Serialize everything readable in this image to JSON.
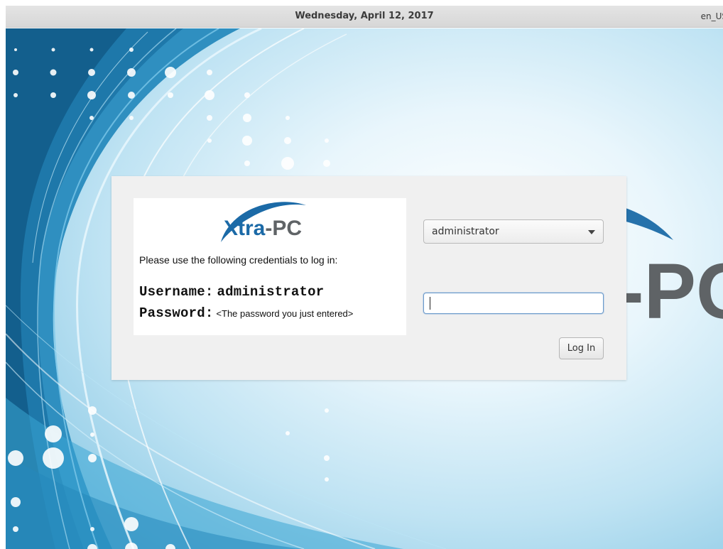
{
  "topbar": {
    "date": "Wednesday, April 12, 2017",
    "locale": "en_US"
  },
  "wallpaper": {
    "logo_text_partial": "-PC"
  },
  "info_card": {
    "logo_x": "X",
    "logo_tra": "tra",
    "logo_pc": "-PC",
    "instruction": "Please use the following credentials to log in:",
    "username_label": "Username:",
    "username_value": "administrator",
    "password_label": "Password:",
    "password_note": "<The password you just entered>"
  },
  "login": {
    "selected_user": "administrator",
    "password_value": "",
    "button_label": "Log In"
  },
  "colors": {
    "logo_blue": "#1b6aa7",
    "logo_grey": "#5f6366",
    "accent": "#6d9ccc"
  },
  "icons": {
    "dropdown": "chevron-down-icon"
  }
}
